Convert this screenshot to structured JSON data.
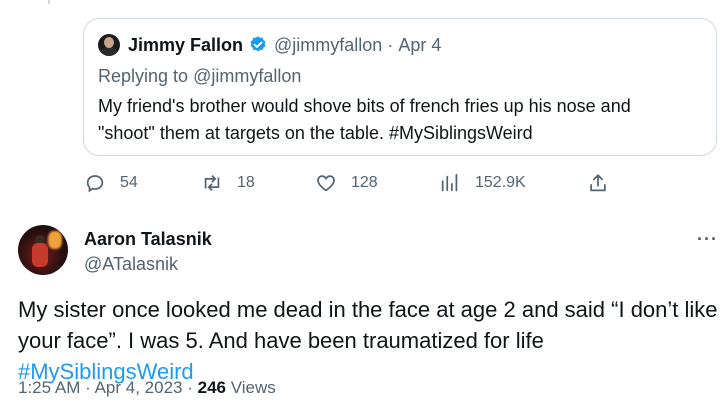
{
  "quoted_tweet": {
    "author_name": "Jimmy Fallon",
    "handle": "@jimmyfallon",
    "separator": "·",
    "date": "Apr 4",
    "replying_prefix": "Replying to",
    "replying_to": "@jimmyfallon",
    "text_line1": "My friend's brother would shove bits of french fries up his nose and",
    "text_line2": "\"shoot\" them at targets on the table. #MySiblingsWeird",
    "verified_color": "#1d9bf0"
  },
  "actions": {
    "reply": {
      "icon": "reply-icon",
      "count": "54"
    },
    "retweet": {
      "icon": "retweet-icon",
      "count": "18"
    },
    "like": {
      "icon": "heart-icon",
      "count": "128"
    },
    "views": {
      "icon": "analytics-icon",
      "count": "152.9K"
    },
    "share": {
      "icon": "share-icon"
    }
  },
  "main_tweet": {
    "author_name": "Aaron Talasnik",
    "handle": "@ATalasnik",
    "more_label": "···",
    "text_line1": "My sister once looked me dead in the face at age 2 and said “I don’t like",
    "text_line2_plain": "your face”. I was 5. And have been traumatized for life ",
    "hashtag": "#MySiblingsWeird",
    "time": "1:25 AM",
    "sep1": "·",
    "date": "Apr 4, 2023",
    "sep2": "·",
    "views_count": "246",
    "views_label": "Views"
  },
  "colors": {
    "link": "#1d9bf0",
    "secondary_text": "#536471",
    "border": "#cfd9de"
  }
}
